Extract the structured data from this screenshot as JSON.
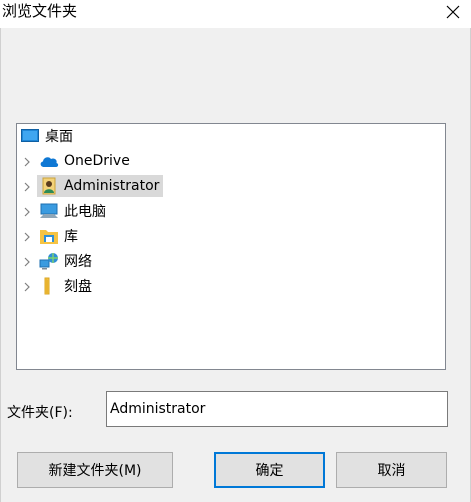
{
  "window": {
    "title": "浏览文件夹",
    "close_symbol": "✕"
  },
  "tree": {
    "root": {
      "label": "桌面",
      "icon": "desktop-icon"
    },
    "items": [
      {
        "label": "OneDrive",
        "icon": "cloud-icon",
        "expandable": true,
        "selected": false
      },
      {
        "label": "Administrator",
        "icon": "user-icon",
        "expandable": true,
        "selected": true
      },
      {
        "label": "此电脑",
        "icon": "computer-icon",
        "expandable": true,
        "selected": false
      },
      {
        "label": "库",
        "icon": "library-icon",
        "expandable": true,
        "selected": false
      },
      {
        "label": "网络",
        "icon": "network-icon",
        "expandable": true,
        "selected": false
      },
      {
        "label": "刻盘",
        "icon": "folder-icon",
        "expandable": true,
        "selected": false
      }
    ]
  },
  "folder_field": {
    "label": "文件夹(F):",
    "value": "Administrator"
  },
  "buttons": {
    "new_folder": "新建文件夹(M)",
    "ok": "确定",
    "cancel": "取消"
  },
  "colors": {
    "accent": "#0078d7",
    "selection": "#d9d9d9",
    "dialog_bg": "#f0f0f0"
  }
}
